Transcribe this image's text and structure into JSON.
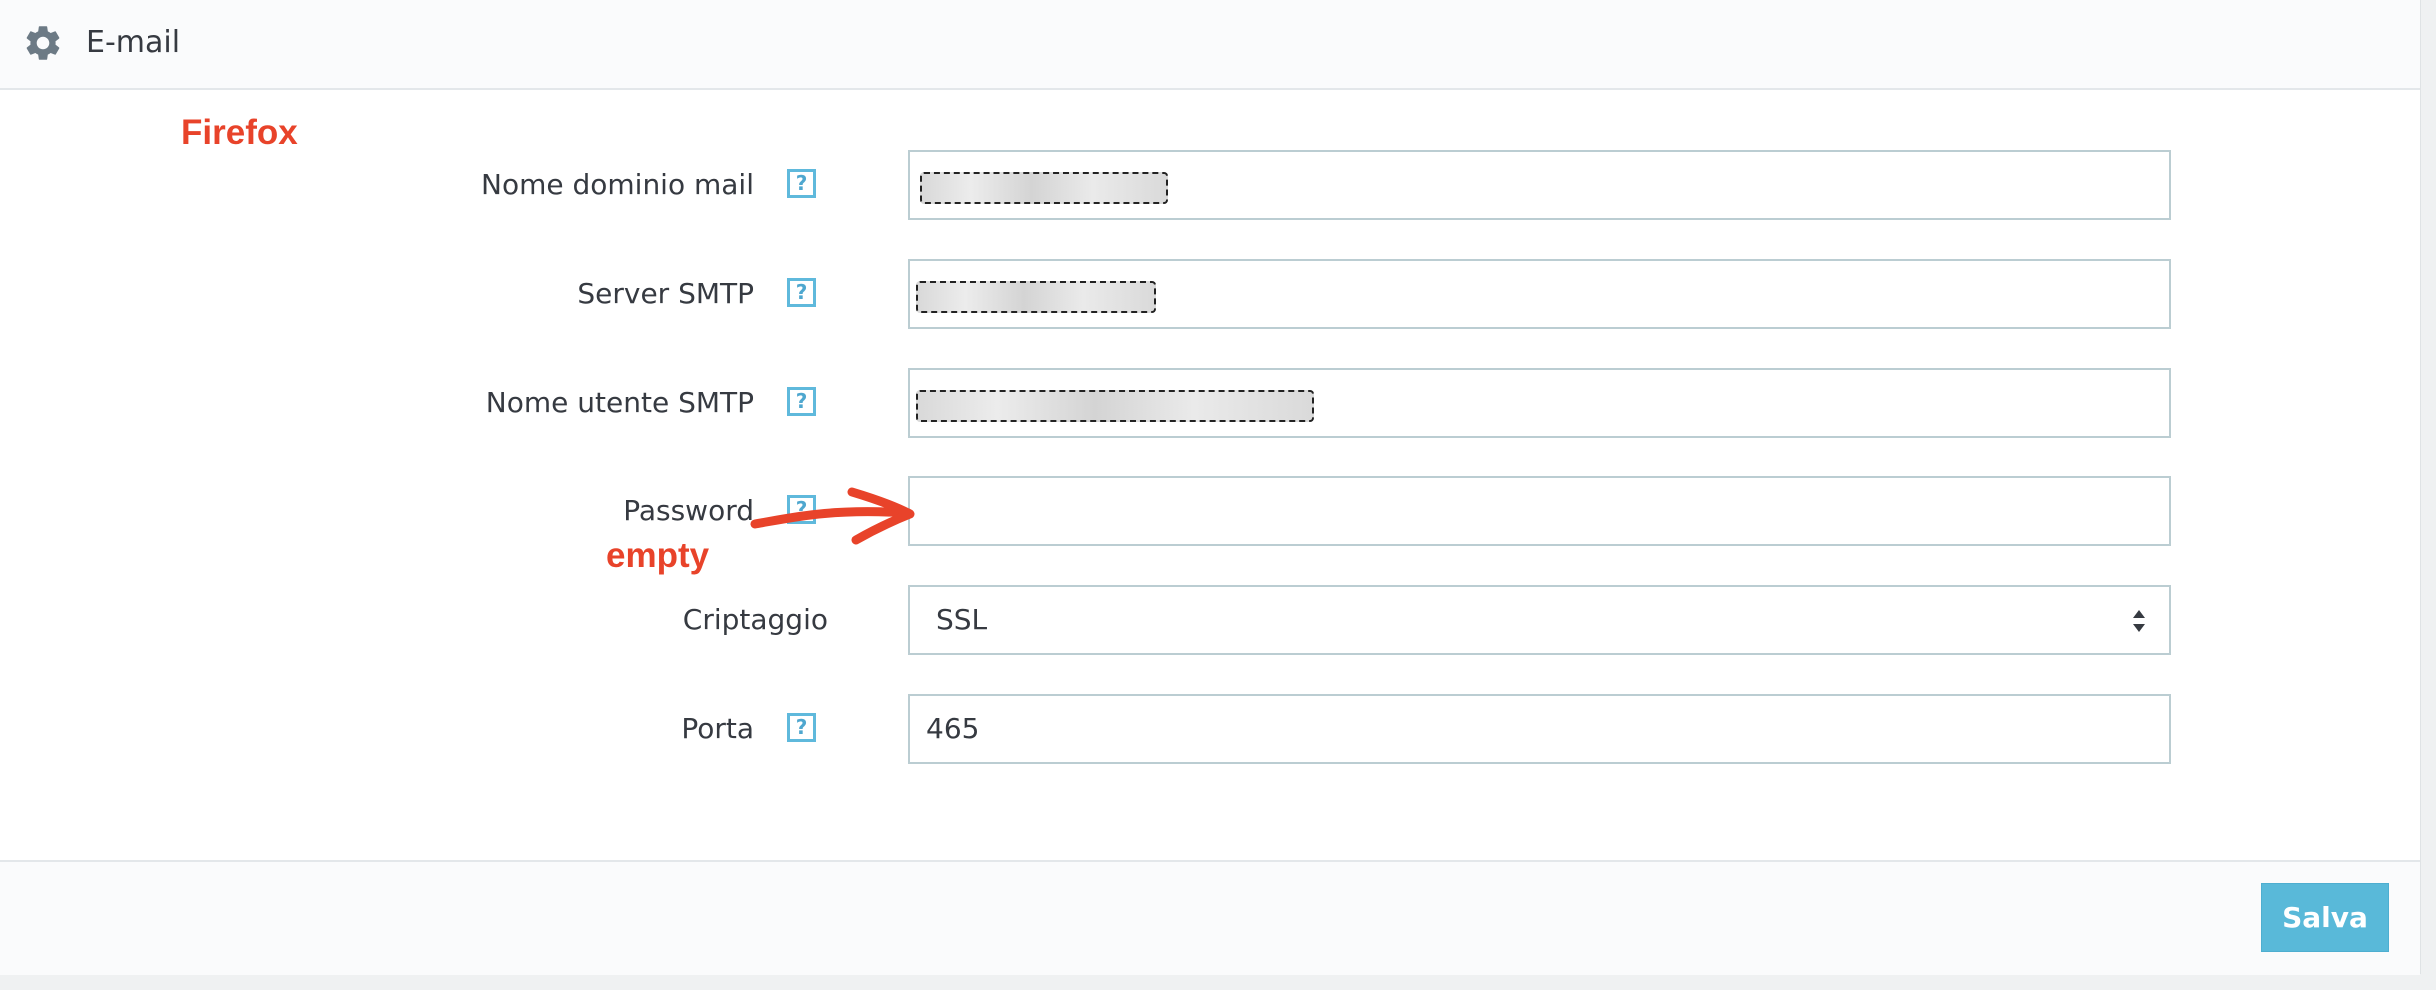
{
  "header": {
    "title": "E-mail",
    "icon": "gear-icon"
  },
  "annotations": {
    "browser": "Firefox",
    "password_note": "empty",
    "color": "#e8432a"
  },
  "form": {
    "fields": [
      {
        "label": "Nome dominio mail",
        "value": "",
        "help": "?",
        "redacted": true
      },
      {
        "label": "Server SMTP",
        "value": "",
        "help": "?",
        "redacted": true
      },
      {
        "label": "Nome utente SMTP",
        "value": "",
        "help": "?",
        "redacted": true
      },
      {
        "label": "Password",
        "value": "",
        "help": "?",
        "redacted": false
      },
      {
        "label": "Criptaggio",
        "value": "SSL",
        "type": "select"
      },
      {
        "label": "Porta",
        "value": "465",
        "help": "?"
      }
    ]
  },
  "footer": {
    "save_label": "Salva",
    "accent": "#59b9d9"
  }
}
